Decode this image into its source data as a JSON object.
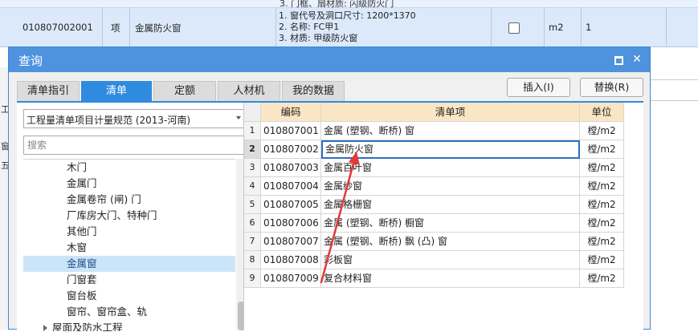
{
  "background": {
    "top_partial_text": "3. 门框、扇材质: 闪级防火门",
    "row": {
      "code": "010807002001",
      "type": "项",
      "name": "金属防火窗",
      "desc_lines": [
        "1. 窗代号及洞口尺寸: 1200*1370",
        "2. 名称: FC甲1",
        "3. 材质: 甲级防火窗"
      ],
      "unit": "m2",
      "qty": "1"
    },
    "left_chars": [
      "工",
      "窗",
      "五"
    ]
  },
  "dialog": {
    "title": "查询",
    "tabs": [
      {
        "label": "清单指引",
        "active": false
      },
      {
        "label": "清单",
        "active": true
      },
      {
        "label": "定额",
        "active": false
      },
      {
        "label": "人材机",
        "active": false
      },
      {
        "label": "我的数据",
        "active": false
      }
    ],
    "insert_button": "插入(I)",
    "replace_button": "替换(R)",
    "spec_select": "工程量清单项目计量规范 (2013-河南)",
    "search_placeholder": "搜索",
    "tree": [
      {
        "label": "木门",
        "selected": false
      },
      {
        "label": "金属门",
        "selected": false
      },
      {
        "label": "金属卷帘 (闸) 门",
        "selected": false
      },
      {
        "label": "厂库房大门、特种门",
        "selected": false
      },
      {
        "label": "其他门",
        "selected": false
      },
      {
        "label": "木窗",
        "selected": false
      },
      {
        "label": "金属窗",
        "selected": true
      },
      {
        "label": "门窗套",
        "selected": false
      },
      {
        "label": "窗台板",
        "selected": false
      },
      {
        "label": "窗帘、窗帘盒、轨",
        "selected": false
      },
      {
        "label": "屋面及防水工程",
        "selected": false,
        "collapsed": true
      }
    ],
    "grid": {
      "headers": [
        "编码",
        "清单项",
        "单位"
      ],
      "rows": [
        {
          "n": "1",
          "code": "010807001",
          "name": "金属 (塑钢、断桥) 窗",
          "unit": "樘/m2"
        },
        {
          "n": "2",
          "code": "010807002",
          "name": "金属防火窗",
          "unit": "樘/m2",
          "selected": true
        },
        {
          "n": "3",
          "code": "010807003",
          "name": "金属百叶窗",
          "unit": "樘/m2"
        },
        {
          "n": "4",
          "code": "010807004",
          "name": "金属纱窗",
          "unit": "樘/m2"
        },
        {
          "n": "5",
          "code": "010807005",
          "name": "金属格栅窗",
          "unit": "樘/m2"
        },
        {
          "n": "6",
          "code": "010807006",
          "name": "金属 (塑钢、断桥) 橱窗",
          "unit": "樘/m2"
        },
        {
          "n": "7",
          "code": "010807007",
          "name": "金属 (塑钢、断桥) 飘 (凸) 窗",
          "unit": "樘/m2"
        },
        {
          "n": "8",
          "code": "010807008",
          "name": "彩板窗",
          "unit": "樘/m2"
        },
        {
          "n": "9",
          "code": "010807009",
          "name": "复合材料窗",
          "unit": "樘/m2"
        }
      ]
    }
  },
  "colors": {
    "titlebar": "#4f93df",
    "active_tab": "#2f8be0",
    "header_bg": "#fae6c4",
    "selection": "#cce4f7",
    "annotation_arrow": "#e03a3a"
  }
}
